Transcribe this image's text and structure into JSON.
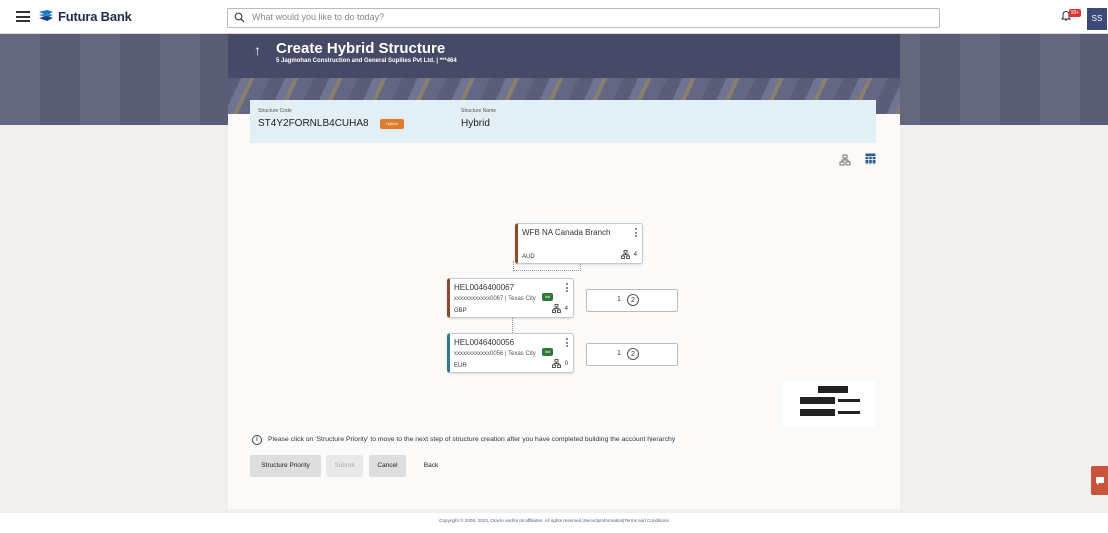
{
  "app": {
    "brand": "Futura Bank",
    "search_placeholder": "What would you like to do today?",
    "notification_badge": "99+",
    "user_initials": "SS"
  },
  "page": {
    "title": "Create Hybrid Structure",
    "subtitle": "5 Jagmohan Construction and General Supllies Pvt Ltd. | ***464"
  },
  "structure": {
    "code_label": "Structure Code",
    "code": "ST4Y2FORNLB4CUHA8",
    "type_tag": "Hybrid",
    "name_label": "Structure Name",
    "name": "Hybrid"
  },
  "hierarchy": {
    "root": {
      "name": "WFB NA Canada Branch",
      "currency": "AUD",
      "children": "4"
    },
    "accounts": [
      {
        "name": "HEL0046400067",
        "detail": "xxxxxxxxxxxx0067 | Texas City",
        "badge": "Ind",
        "currency": "GBP",
        "children": "4",
        "priority": "1",
        "priority_count": "2",
        "accent": "#8a4b2a"
      },
      {
        "name": "HEL0046400056",
        "detail": "xxxxxxxxxxxx0056 | Texas City",
        "badge": "Ind",
        "currency": "EUR",
        "children": "0",
        "priority": "1",
        "priority_count": "2",
        "accent": "#2e7a8a"
      }
    ]
  },
  "note": "Please click on 'Structure Priority' to move to the next step of structure creation after you have completed building the account hierarchy",
  "buttons": {
    "structure_priority": "Structure Priority",
    "submit": "Submit",
    "cancel": "Cancel",
    "back": "Back"
  },
  "footer": "Copyright © 2006, 2023, Oracle and/or its affiliates. All rights reserved.|SecurityInformation|Terms and Conditions",
  "colors": {
    "header": "#474a66",
    "accent_orange": "#e07a2c",
    "badge_green": "#2f7a3a"
  }
}
